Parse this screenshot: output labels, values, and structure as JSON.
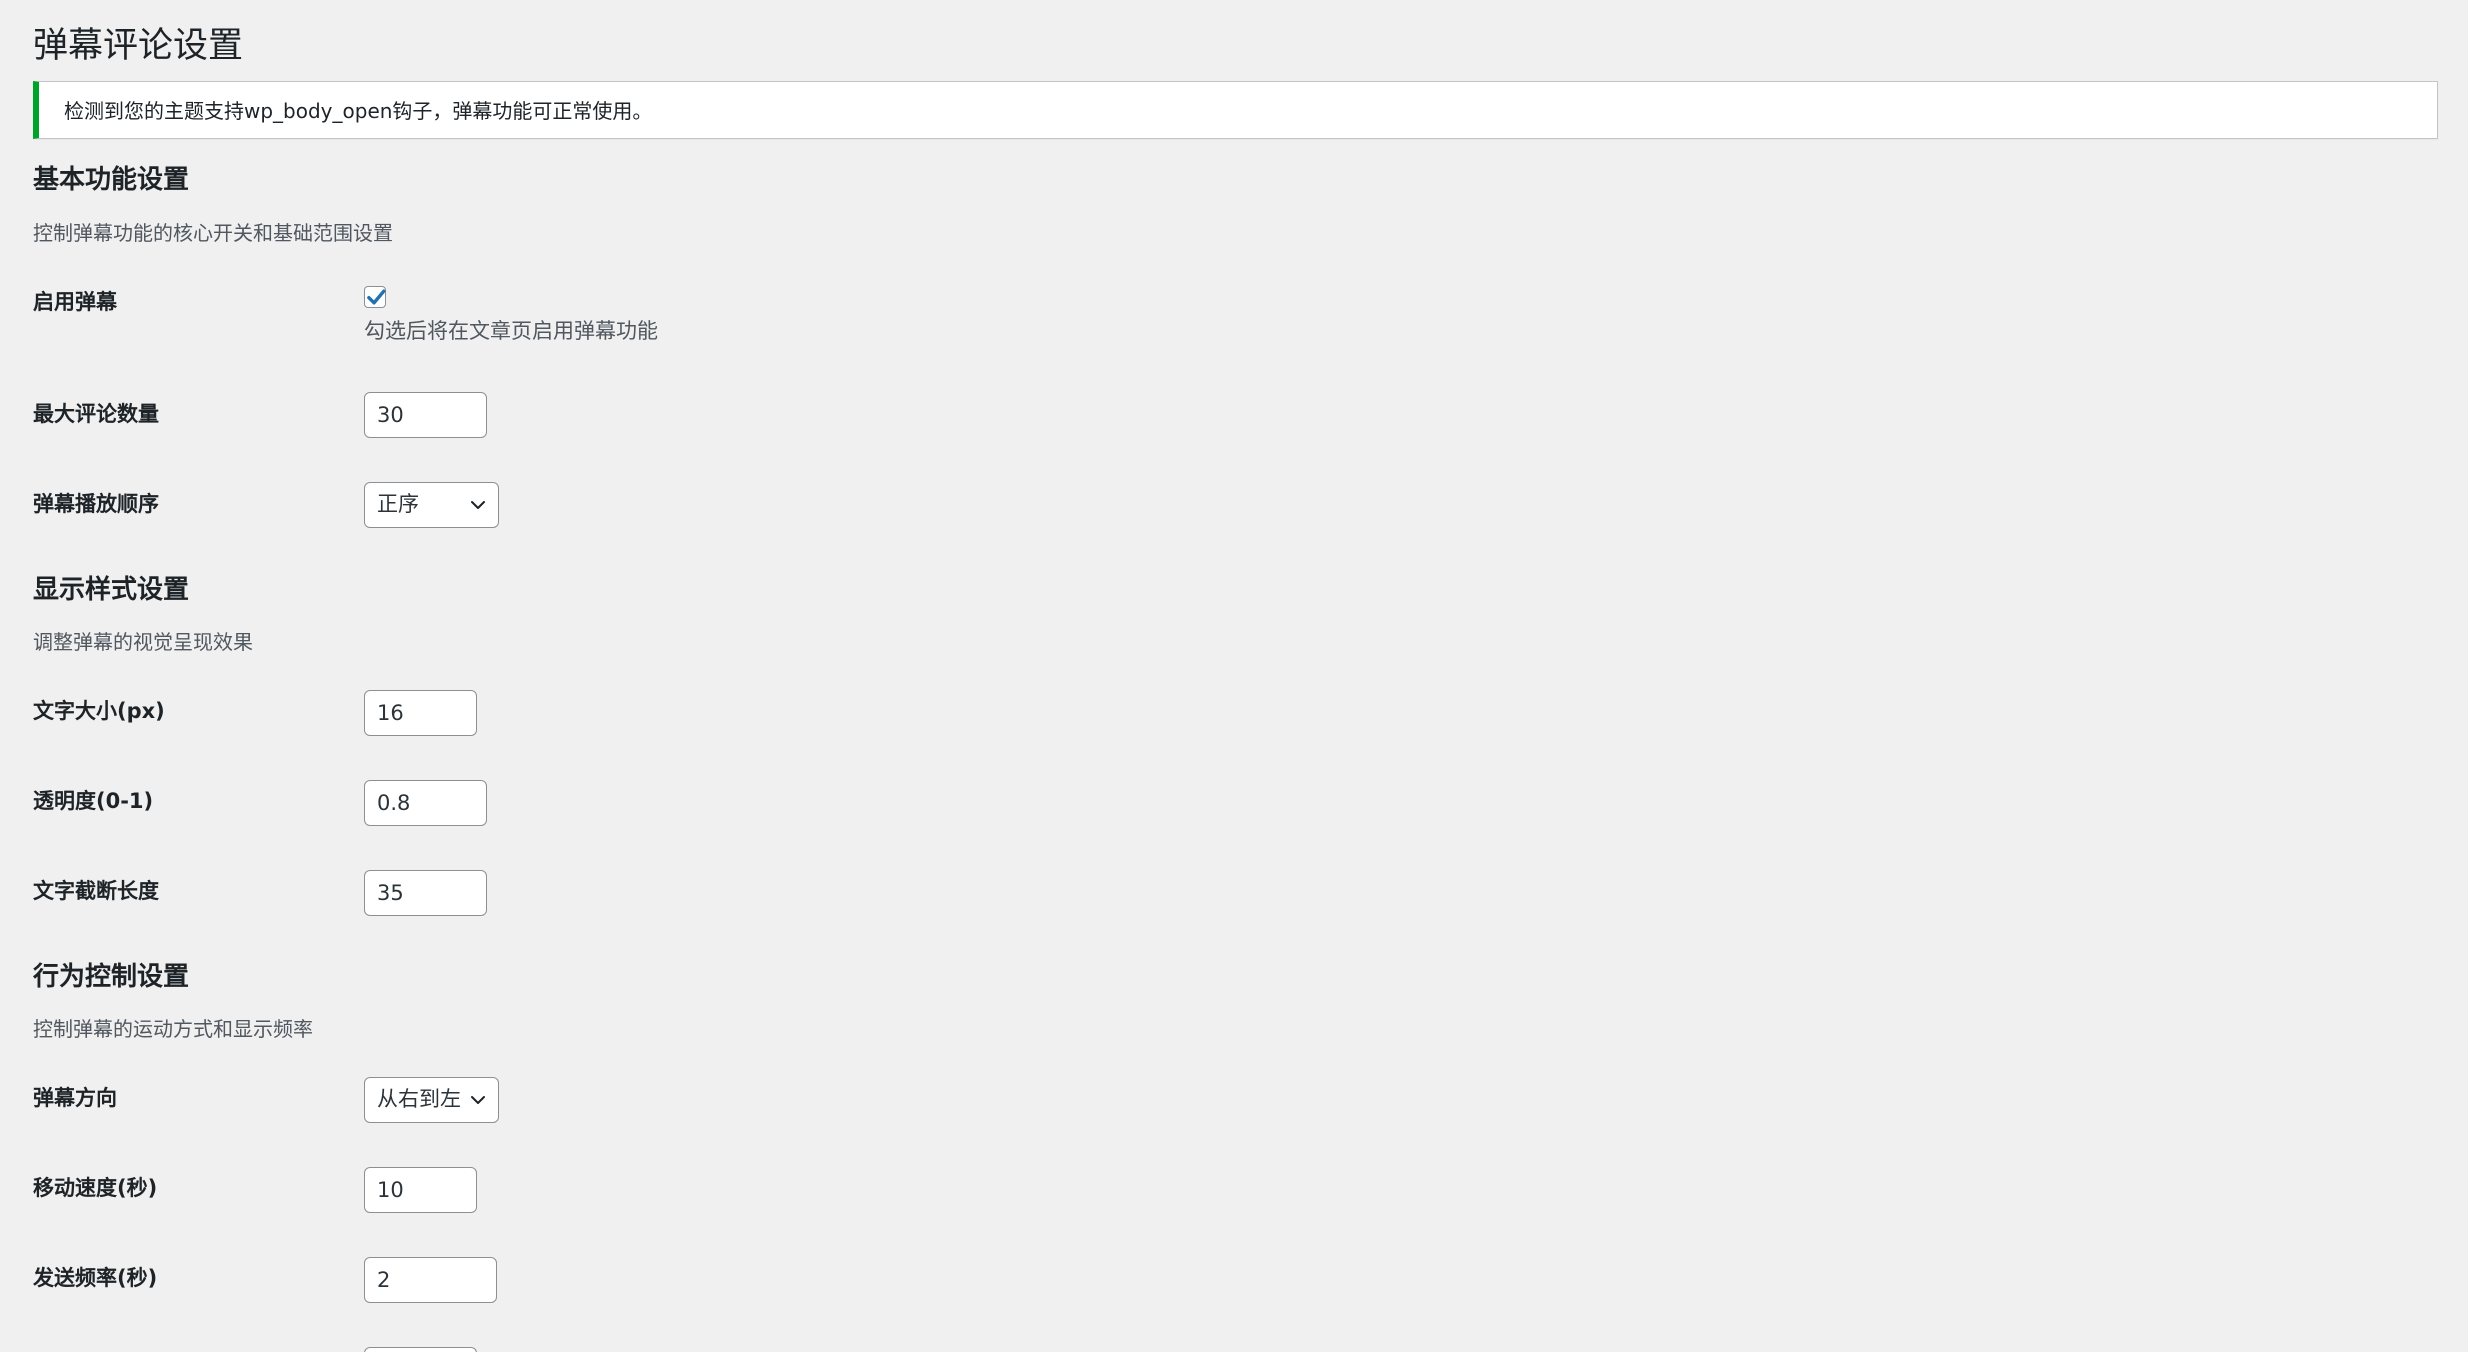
{
  "page": {
    "title": "弹幕评论设置"
  },
  "notice": {
    "text": "检测到您的主题支持wp_body_open钩子，弹幕功能可正常使用。",
    "status_color": "#00a32a"
  },
  "sections": {
    "basic": {
      "title": "基本功能设置",
      "description": "控制弹幕功能的核心开关和基础范围设置",
      "enable": {
        "label": "启用弹幕",
        "checked": true,
        "hint": "勾选后将在文章页启用弹幕功能"
      },
      "max_comments": {
        "label": "最大评论数量",
        "value": "30"
      },
      "order": {
        "label": "弹幕播放顺序",
        "selected": "正序"
      }
    },
    "style": {
      "title": "显示样式设置",
      "description": "调整弹幕的视觉呈现效果",
      "font_size": {
        "label": "文字大小(px)",
        "value": "16"
      },
      "opacity": {
        "label": "透明度(0-1)",
        "value": "0.8"
      },
      "truncate": {
        "label": "文字截断长度",
        "value": "35"
      }
    },
    "behavior": {
      "title": "行为控制设置",
      "description": "控制弹幕的运动方式和显示频率",
      "direction": {
        "label": "弹幕方向",
        "selected": "从右到左"
      },
      "speed": {
        "label": "移动速度(秒)",
        "value": "10"
      },
      "frequency": {
        "label": "发送频率(秒)",
        "value": "2"
      }
    }
  },
  "colors": {
    "background": "#f0f0f1",
    "checkbox_accent": "#2271b1",
    "field_border": "#8c8f94"
  },
  "icons": {
    "checkmark": "checkmark-icon",
    "dropdown": "chevron-down-icon"
  }
}
